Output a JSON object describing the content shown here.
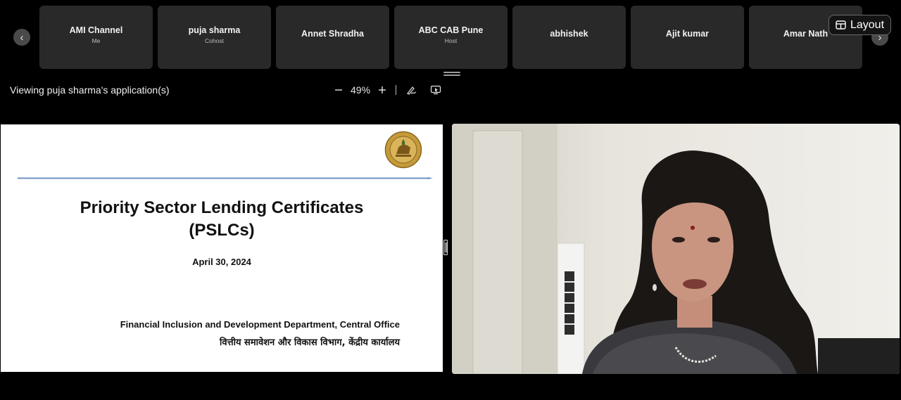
{
  "participants_strip": {
    "prev_icon": "chevron-left-icon",
    "next_icon": "chevron-right-icon",
    "participants": [
      {
        "name": "AMI Channel",
        "role": "Me"
      },
      {
        "name": "puja sharma",
        "role": "Cohost"
      },
      {
        "name": "Annet Shradha",
        "role": ""
      },
      {
        "name": "ABC CAB Pune",
        "role": "Host"
      },
      {
        "name": "abhishek",
        "role": ""
      },
      {
        "name": "Ajit kumar",
        "role": ""
      },
      {
        "name": "Amar Nath",
        "role": ""
      }
    ],
    "layout_label": "Layout"
  },
  "share_toolbar": {
    "viewing_text": "Viewing puja sharma's application(s)",
    "zoom_level": "49%"
  },
  "slide": {
    "title_line1": "Priority Sector Lending Certificates",
    "title_line2": "(PSLCs)",
    "date": "April 30, 2024",
    "department_en": "Financial Inclusion and Development Department, Central Office",
    "department_hi": "वित्तीय समावेशन और विकास विभाग, केंद्रीय कार्यालय",
    "arrow_color": "#6d93bf"
  },
  "colors": {
    "background": "#000000",
    "tile": "#292929",
    "seal_gold": "#c59a3a"
  }
}
